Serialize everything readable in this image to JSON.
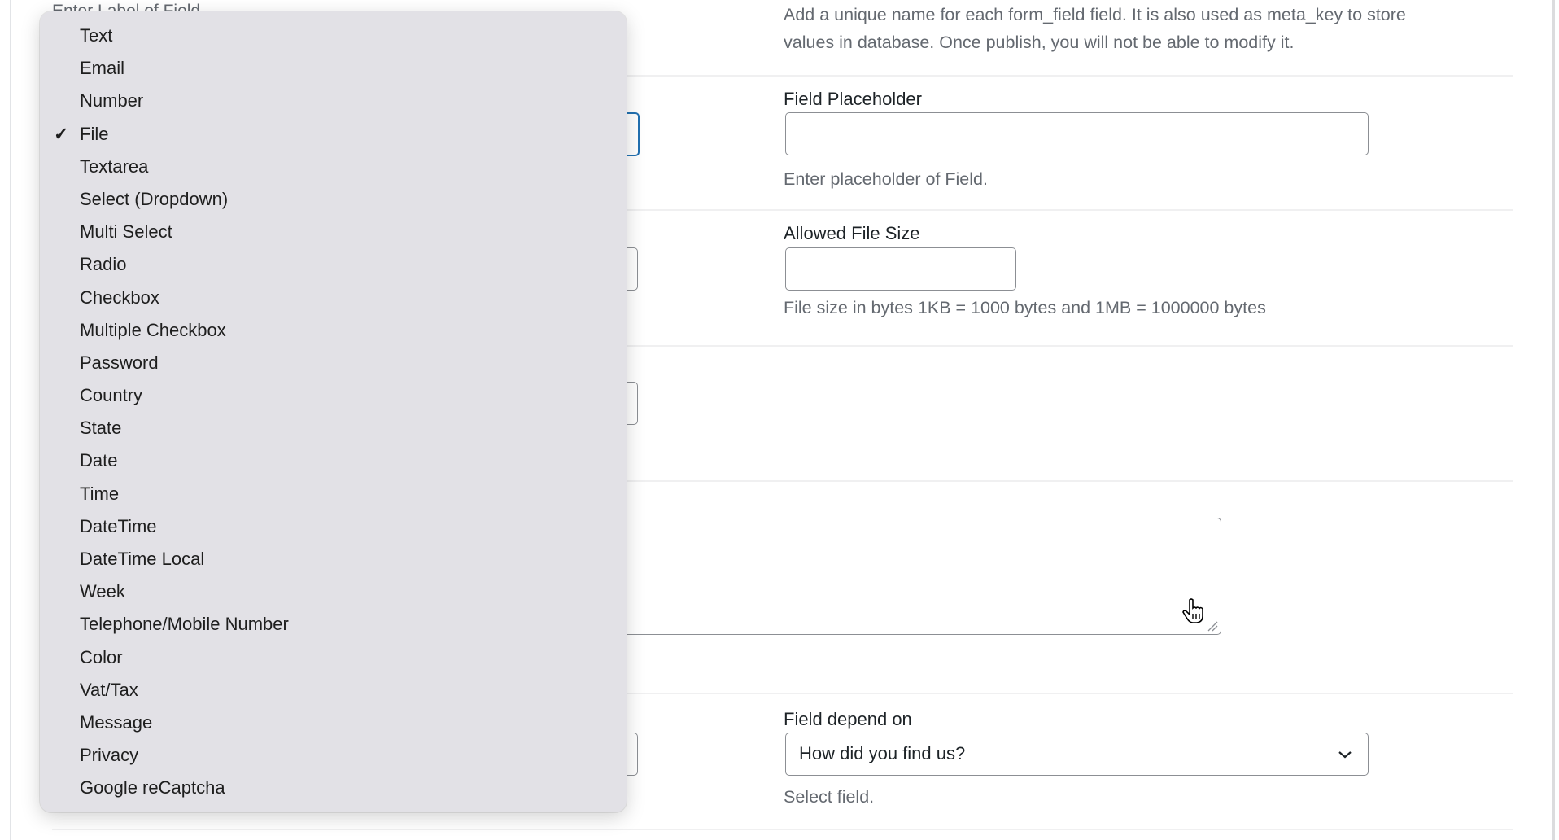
{
  "background_form": {
    "label_hint": "Enter Label of Field",
    "name_description": "Add a unique name for each form_field field. It is also used as meta_key to store values in database. Once publish, you will not be able to modify it.",
    "name_description_line1": "Add a unique name for each form_field field. It is also used as meta_key to store",
    "name_description_line2": "values in database. Once publish, you will not be able to modify it.",
    "placeholder_label": "Field Placeholder",
    "placeholder_value": "",
    "placeholder_help": "Enter placeholder of Field.",
    "file_size_label": "Allowed File Size",
    "file_size_value": "",
    "file_size_help": "File size in bytes 1KB = 1000 bytes and 1MB = 1000000 bytes",
    "depend_label": "Field depend on",
    "depend_value": "How did you find us?",
    "depend_help": "Select field."
  },
  "type_menu": {
    "selected": "File",
    "items": [
      "Text",
      "Email",
      "Number",
      "File",
      "Textarea",
      "Select (Dropdown)",
      "Multi Select",
      "Radio",
      "Checkbox",
      "Multiple Checkbox",
      "Password",
      "Country",
      "State",
      "Date",
      "Time",
      "DateTime",
      "DateTime Local",
      "Week",
      "Telephone/Mobile Number",
      "Color",
      "Vat/Tax",
      "Message",
      "Privacy",
      "Google reCaptcha"
    ]
  },
  "colors": {
    "focus": "#2271b1",
    "menu_bg": "#e2e1e6",
    "help_text": "#646970"
  }
}
